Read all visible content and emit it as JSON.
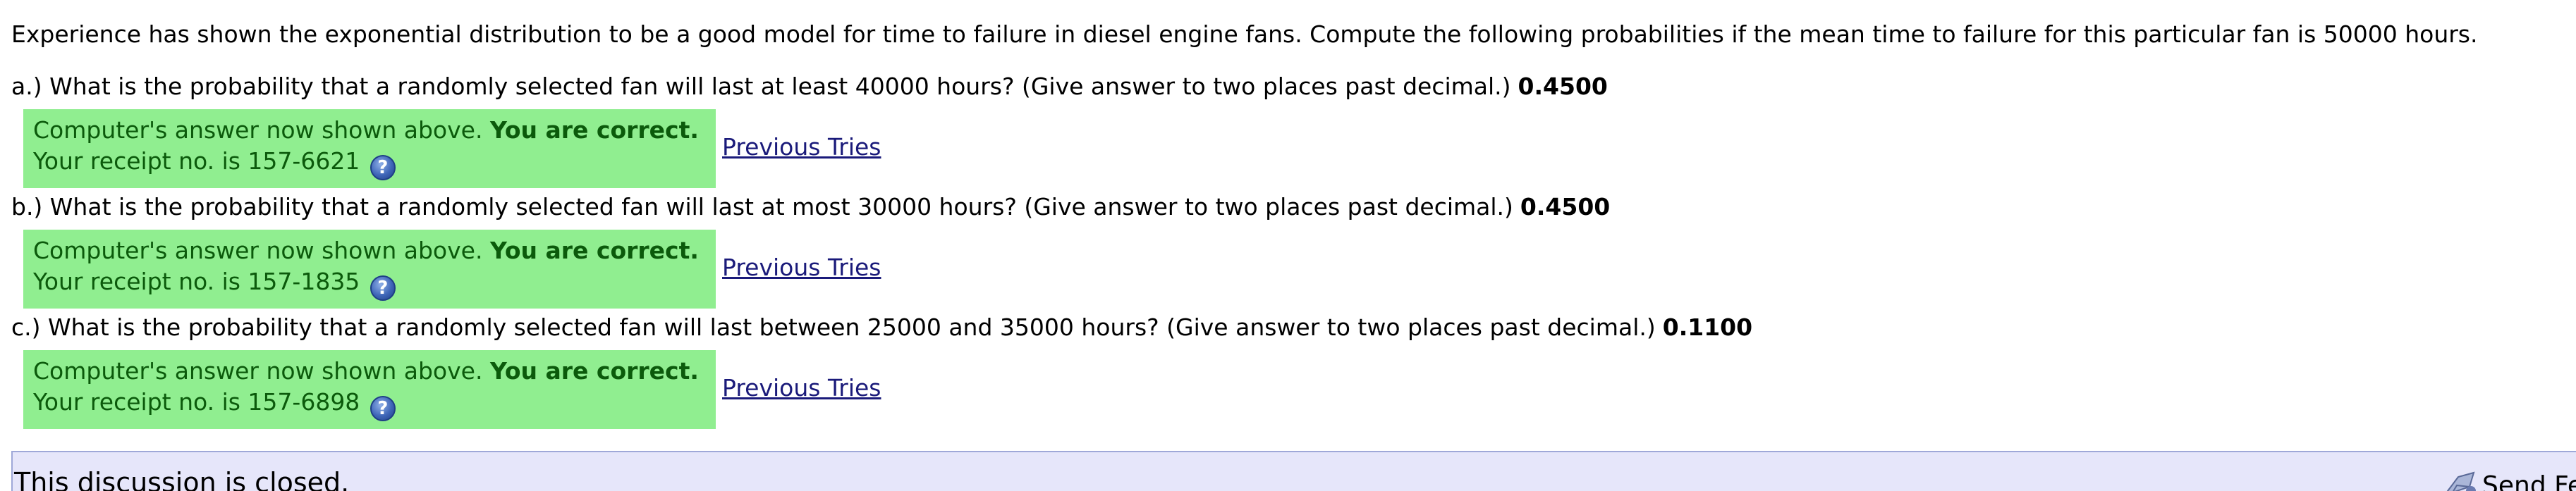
{
  "intro": "Experience has shown the exponential distribution to be a good model for time to failure in diesel engine fans. Compute the following probabilities if the mean time to failure for this particular fan is 50000 hours.",
  "questions": [
    {
      "text": "a.) What is the probability that a randomly selected fan will last at least 40000 hours? (Give answer to two places past decimal.)",
      "answer": "0.4500",
      "feedback_line1": "Computer's answer now shown above.",
      "feedback_correct": "You are correct.",
      "receipt": "Your receipt no. is 157-6621",
      "previous_tries": "Previous Tries"
    },
    {
      "text": "b.) What is the probability that a randomly selected fan will last at most 30000 hours? (Give answer to two places past decimal.)",
      "answer": "0.4500",
      "feedback_line1": "Computer's answer now shown above.",
      "feedback_correct": "You are correct.",
      "receipt": "Your receipt no. is 157-1835",
      "previous_tries": "Previous Tries"
    },
    {
      "text": "c.) What is the probability that a randomly selected fan will last between 25000 and 35000 hours? (Give answer to two places past decimal.)",
      "answer": "0.1100",
      "feedback_line1": "Computer's answer now shown above.",
      "feedback_correct": "You are correct.",
      "receipt": "Your receipt no. is 157-6898",
      "previous_tries": "Previous Tries"
    }
  ],
  "help_icon_glyph": "?",
  "discussion": {
    "closed_text": "This discussion is closed.",
    "send_feedback": "Send Fe"
  },
  "colors": {
    "feedback_bg": "#90ee90",
    "feedback_text": "#0b5a0b",
    "link": "#1a1a7a",
    "discussion_bg": "#e6e6fa"
  }
}
